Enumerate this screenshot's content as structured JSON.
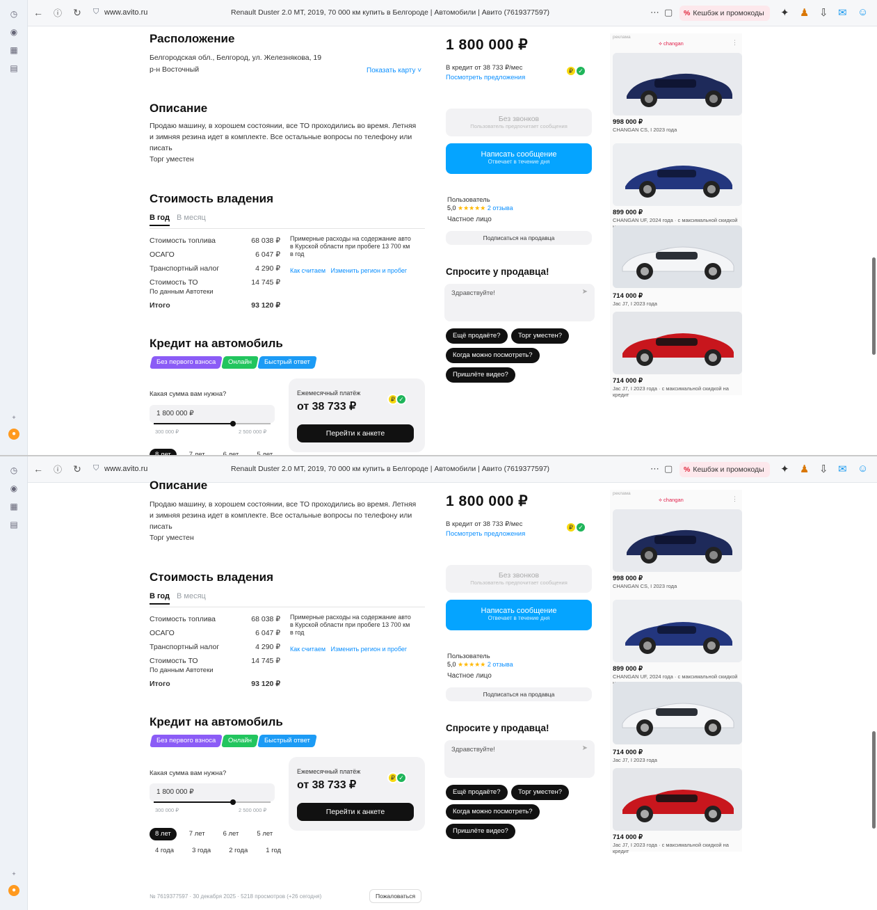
{
  "browser": {
    "host": "www.avito.ru",
    "page_title": "Renault Duster 2.0 MT, 2019, 70 000 км купить в Белгороде | Автомобили | Авито (7619377597)",
    "promo_label": "Кешбэк и промокоды"
  },
  "location": {
    "heading": "Расположение",
    "address_line1": "Белгородская обл., Белгород, ул. Железнякова, 19",
    "address_line2": "р-н Восточный",
    "map_link": "Показать карту ˅"
  },
  "description": {
    "heading": "Описание",
    "text_line1": "Продаю машину, в хорошем состоянии, все ТО проходились во время. Летняя",
    "text_line2": "и зимняя резина идет в комплекте. Все остальные вопросы по телефону или",
    "text_line3": "писать",
    "text_line4": "Торг уместен"
  },
  "ownership": {
    "heading": "Стоимость владения",
    "tab_year": "В год",
    "tab_month": "В месяц",
    "rows": [
      {
        "label": "Стоимость топлива",
        "value": "68 038 ₽"
      },
      {
        "label": "ОСАГО",
        "value": "6 047 ₽"
      },
      {
        "label": "Транспортный налог",
        "value": "4 290 ₽"
      },
      {
        "label": "Стоимость ТО",
        "value": "14 745 ₽"
      }
    ],
    "source": "По данным Автотеки",
    "total_label": "Итого",
    "total_value": "93 120 ₽",
    "note_line1": "Примерные расходы на содержание авто",
    "note_line2": "в Курской области при пробеге 13 700 км",
    "note_line3": "в год",
    "how_link": "Как считаем",
    "change_link": "Изменить регион и пробег"
  },
  "credit": {
    "heading": "Кредит на автомобиль",
    "tags": [
      "Без первого взноса",
      "Онлайн",
      "Быстрый ответ"
    ],
    "sum_question": "Какая сумма вам нужна?",
    "sum_value": "1 800 000 ₽",
    "range_min": "300 000 ₽",
    "range_max": "2 500 000 ₽",
    "terms_row1": [
      "8 лет",
      "7 лет",
      "6 лет",
      "5 лет"
    ],
    "terms_row2": [
      "4 года",
      "3 года",
      "2 года",
      "1 год"
    ],
    "monthly_label": "Ежемесячный платёж",
    "monthly_value": "от 38 733 ₽",
    "apply_button": "Перейти к анкете",
    "slider_fraction": 0.68
  },
  "sidebar": {
    "price": "1 800 000 ₽",
    "credit_text": "В кредит от 38 733 ₽/мес",
    "offers_link": "Посмотреть предложения",
    "no_calls_title": "Без звонков",
    "no_calls_sub": "Пользователь предпочитает сообщения",
    "write_button": "Написать сообщение",
    "write_sub": "Отвечает в течение дня",
    "seller_type": "Пользователь",
    "rating": "5,0",
    "stars": "★★★★★",
    "reviews_link": "2 отзыва",
    "seller_kind": "Частное лицо",
    "subscribe_button": "Подписаться на продавца",
    "ask_heading": "Спросите у продавца!",
    "ask_placeholder": "Здравствуйте!",
    "quick_questions": [
      "Ещё продаёте?",
      "Торг уместен?",
      "Когда можно посмотреть?",
      "Пришлёте видео?"
    ]
  },
  "recommendations": {
    "label": "реклама",
    "brand": "changan",
    "items": [
      {
        "price": "998 000 ₽",
        "desc": "CHANGAN CS, I 2023 года"
      },
      {
        "price": "899 000 ₽",
        "desc": "CHANGAN UF, 2024 года · с максимальной скидкой на кредит"
      },
      {
        "price": "714 000 ₽",
        "desc": "Jac J7, I 2023 года"
      },
      {
        "price": "714 000 ₽",
        "desc": "Jac J7, I 2023 года · с максимальной скидкой на кредит"
      }
    ]
  },
  "footer": {
    "meta": "№ 7619377597 · 30 декабря 2025 · 5218 просмотров (+26 сегодня)",
    "complain_button": "Пожаловаться"
  },
  "colors": {
    "accent_blue": "#05a4ff",
    "tag_purple": "#8b5cf6",
    "tag_green": "#22c55e",
    "tag_blue": "#1c9bf5",
    "coin_yellow": "#f7d80d"
  }
}
